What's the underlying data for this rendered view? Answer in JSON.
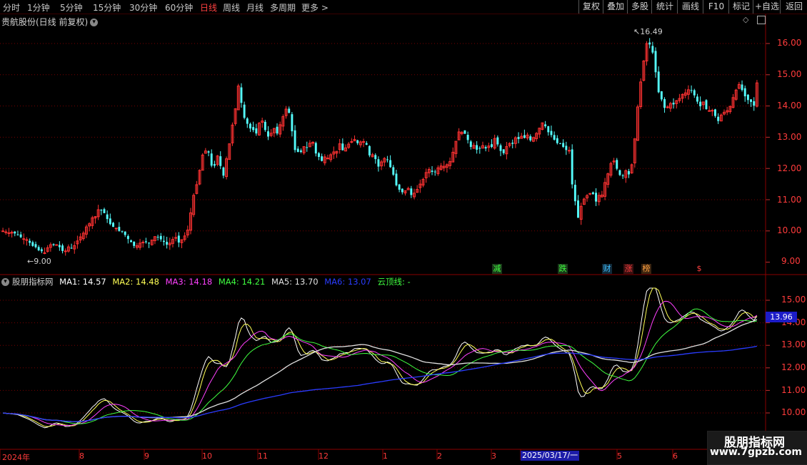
{
  "toolbar": {
    "periods": [
      "分时",
      "1分钟",
      "5分钟",
      "15分钟",
      "30分钟",
      "60分钟",
      "日线",
      "周线",
      "月线",
      "多周期",
      "更多 >"
    ],
    "active_period": "日线",
    "buttons": [
      "复权",
      "叠加",
      "多股",
      "统计",
      "画线",
      "F10",
      "标记",
      "+自选",
      "返回"
    ]
  },
  "stock_title": "贵航股份(日线 前复权)",
  "price_labels": [
    "16.00",
    "15.00",
    "14.00",
    "13.00",
    "12.00",
    "11.00",
    "10.00",
    "9.00"
  ],
  "high_marker": "16.49",
  "low_marker": "9.00",
  "events": [
    "减",
    "跌",
    "财",
    "涨",
    "榜",
    "$"
  ],
  "indicator": {
    "name": "股朋指标网",
    "ma1": "MA1: 14.57",
    "ma2": "MA2: 14.48",
    "ma3": "MA3: 14.18",
    "ma4": "MA4: 14.21",
    "ma5": "MA5: 13.70",
    "ma6": "MA6: 13.07",
    "cloud": "云顶线: -",
    "current_value": "13.96",
    "labels": [
      "15.00",
      "14.00",
      "13.00",
      "12.00",
      "11.00",
      "10.00"
    ]
  },
  "dates": [
    "2024年",
    "8",
    "9",
    "10",
    "11",
    "12",
    "1",
    "2",
    "3",
    "2025/03/17/一",
    "5",
    "6"
  ],
  "watermark": {
    "line1": "股朋指标网",
    "line2": "www.7gpzb.com"
  },
  "colors": {
    "up": "#ff3232",
    "down": "#54fcfc",
    "grid": "#7a0000",
    "ma1": "#ffffff",
    "ma2": "#ffff55",
    "ma3": "#ff40ff",
    "ma4": "#40ff40",
    "ma5": "#e0e0e0",
    "ma6": "#2a3cff"
  },
  "closes": [
    10.0,
    9.97,
    9.94,
    9.96,
    9.92,
    9.88,
    9.8,
    9.75,
    9.72,
    9.62,
    9.52,
    9.48,
    9.38,
    9.35,
    9.3,
    9.46,
    9.56,
    9.55,
    9.56,
    9.48,
    9.36,
    9.36,
    9.49,
    9.45,
    9.53,
    9.68,
    9.81,
    9.93,
    10.13,
    10.23,
    10.42,
    10.46,
    10.68,
    10.65,
    10.57,
    10.38,
    10.22,
    10.13,
    10.09,
    10.0,
    9.98,
    9.87,
    9.74,
    9.64,
    9.52,
    9.53,
    9.61,
    9.64,
    9.64,
    9.61,
    9.71,
    9.82,
    9.79,
    9.73,
    9.65,
    9.56,
    9.61,
    9.73,
    9.79,
    9.63,
    9.72,
    9.84,
    10.03,
    10.58,
    11.14,
    11.48,
    11.94,
    12.43,
    12.56,
    12.51,
    12.09,
    12.09,
    12.4,
    12.08,
    11.77,
    12.31,
    12.79,
    13.39,
    13.91,
    14.64,
    14.1,
    13.62,
    13.43,
    13.28,
    13.23,
    13.12,
    13.45,
    13.52,
    13.23,
    13.02,
    13.13,
    13.28,
    13.12,
    13.4,
    13.66,
    13.9,
    13.78,
    13.19,
    12.59,
    12.53,
    12.53,
    12.7,
    12.68,
    12.81,
    12.84,
    12.48,
    12.37,
    12.24,
    12.37,
    12.33,
    12.44,
    12.53,
    12.55,
    12.79,
    12.58,
    12.66,
    12.78,
    12.86,
    12.93,
    12.81,
    12.85,
    12.86,
    12.76,
    12.42,
    12.44,
    12.3,
    12.06,
    12.21,
    12.32,
    12.27,
    12.04,
    11.8,
    11.46,
    11.32,
    11.24,
    11.29,
    11.36,
    11.15,
    11.21,
    11.33,
    11.5,
    11.65,
    11.87,
    11.97,
    11.89,
    11.88,
    12.02,
    12.08,
    12.07,
    12.12,
    12.22,
    12.52,
    12.87,
    13.17,
    13.16,
    13.11,
    12.91,
    12.69,
    12.74,
    12.6,
    12.63,
    12.73,
    12.64,
    12.72,
    12.69,
    12.96,
    12.77,
    12.56,
    12.49,
    12.7,
    12.8,
    12.79,
    12.98,
    12.94,
    13.03,
    12.98,
    13.07,
    12.9,
    12.99,
    13.12,
    13.29,
    13.46,
    13.35,
    13.16,
    13.07,
    12.92,
    12.81,
    12.8,
    12.69,
    12.59,
    12.58,
    11.49,
    10.95,
    10.42,
    10.79,
    11.02,
    11.13,
    11.2,
    11.18,
    10.94,
    11.14,
    11.15,
    11.55,
    11.83,
    12.16,
    12.24,
    11.99,
    11.79,
    11.77,
    11.93,
    11.81,
    12.12,
    12.95,
    13.97,
    14.77,
    15.44,
    16.0,
    15.97,
    15.71,
    15.08,
    14.44,
    14.21,
    13.94,
    13.97,
    14.08,
    14.05,
    14.17,
    14.24,
    14.37,
    14.42,
    14.52,
    14.49,
    14.34,
    14.14,
    13.99,
    14.13,
    13.9,
    13.85,
    13.86,
    13.68,
    13.52,
    13.71,
    13.8,
    13.85,
    13.98,
    14.27,
    14.51,
    14.69,
    14.51,
    14.31,
    14.19,
    14.13,
    14.01,
    14.74
  ]
}
